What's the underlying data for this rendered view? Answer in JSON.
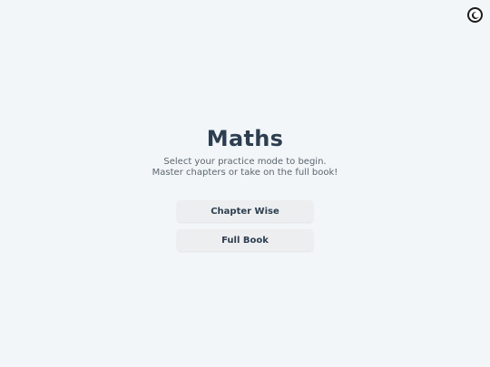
{
  "theme_toggle": {
    "icon": "moon-icon"
  },
  "main": {
    "title": "Maths",
    "subtitle": "Select your practice mode to begin. Master chapters or take on the full book!",
    "buttons": {
      "chapter_wise": "Chapter Wise",
      "full_book": "Full Book"
    }
  },
  "colors": {
    "background": "#f3f6f8",
    "title": "#2c3e50",
    "button_bg": "#eceeef"
  }
}
